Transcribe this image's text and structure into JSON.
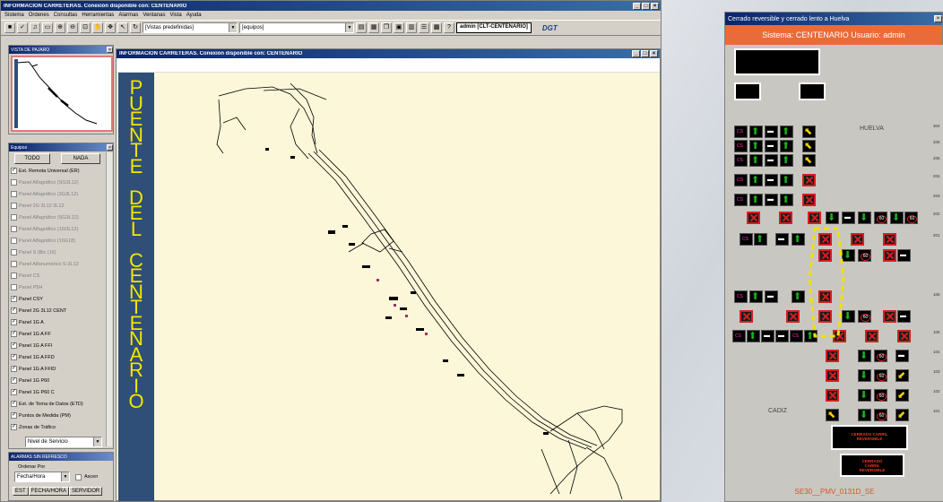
{
  "main": {
    "title": "INFORMACION CARRETERAS. Conexión disponible con: CENTENARIO",
    "menu": [
      "Sistema",
      "Ordenes",
      "Consultas",
      "Herramientas",
      "Alarmas",
      "Ventanas",
      "Vista",
      "Ayuda"
    ],
    "views_combo": "[Vistas predefinidas]",
    "equipos_combo": "[equipos]",
    "user": "admin [CLT-CENTENARIO]",
    "brand": "DGT"
  },
  "overview": {
    "title": "VISTA DE PAJARO"
  },
  "equipos": {
    "title": "Equipos",
    "btn_all": "TODO",
    "btn_none": "NADA",
    "layers": [
      {
        "label": "Est. Remota Universal (ER)",
        "on": true
      },
      {
        "label": "Panel Alfagráfico (SG3L12)",
        "on": false
      },
      {
        "label": "Panel Alfagráfico (3G3L12)",
        "on": false
      },
      {
        "label": "Panel 2G 3L12 3L12",
        "on": false
      },
      {
        "label": "Panel Alfagráfico (SG3L12)",
        "on": false
      },
      {
        "label": "Panel Alfagráfico (16/3L12)",
        "on": false
      },
      {
        "label": "Panel Alfagráfico (16G18)",
        "on": false
      },
      {
        "label": "Panel S (Bic (16)",
        "on": false
      },
      {
        "label": "Panel Alfanumérico S-3L12",
        "on": false
      },
      {
        "label": "Panel CS",
        "on": false
      },
      {
        "label": "Panel P5H",
        "on": false
      },
      {
        "label": "Panel CSY",
        "on": true
      },
      {
        "label": "Panel 2G 3L12 CENT",
        "on": true
      },
      {
        "label": "Panel 1G A",
        "on": true
      },
      {
        "label": "Panel 1G A FF",
        "on": true
      },
      {
        "label": "Panel 1G A FFI",
        "on": true
      },
      {
        "label": "Panel 1G A FFD",
        "on": true
      },
      {
        "label": "Panel 1G A FFID",
        "on": true
      },
      {
        "label": "Panel 1G P60",
        "on": true
      },
      {
        "label": "Panel 1G P60 C",
        "on": true
      },
      {
        "label": "Est. de Toma de Datos (ETD)",
        "on": true
      },
      {
        "label": "Puntos de Medida (PM)",
        "on": true
      },
      {
        "label": "Zonas de Tráfico",
        "on": true
      }
    ],
    "nivel_combo": "Nivel de Servicio"
  },
  "alarmas": {
    "title": "ALARMAS SIN REFRESCO",
    "ordenar_label": "Ordenar Por",
    "ordenar_value": "Fecha/Hora",
    "asc_label": "Ascen",
    "col1": "EST",
    "col2": "FECHA/HORA",
    "col3": "SERVIDOR"
  },
  "map": {
    "title": "INFORMACION CARRETERAS. Conexión disponible con: CENTENARIO",
    "band_letters": [
      "P",
      "U",
      "E",
      "N",
      "T",
      "E",
      "",
      "D",
      "E",
      "L",
      "",
      "C",
      "E",
      "N",
      "T",
      "E",
      "N",
      "A",
      "R",
      "I",
      "O"
    ]
  },
  "right": {
    "title": "Cerrado reversible y cerrado lento a Huelva",
    "sistema": "Sistema: CENTENARIO   Usuario: admin",
    "huelva": "HUELVA",
    "cadiz": "CADIZ",
    "vms1": "CERRADO CARRIL REVERSIBLE",
    "vms2": "CERRADO CARRIL REVERSIBLE",
    "footer": "SE30__PMV_0131D_SE",
    "km": [
      "304",
      "206",
      "205",
      "204",
      "203",
      "202",
      "201",
      "106",
      "105",
      "104",
      "103",
      "102",
      "101"
    ]
  }
}
